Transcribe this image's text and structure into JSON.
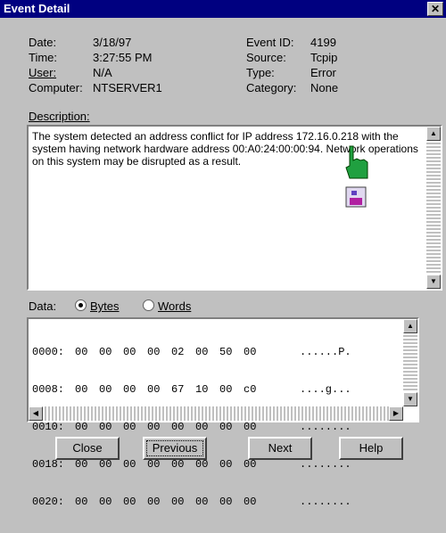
{
  "window": {
    "title": "Event Detail",
    "close_glyph": "✕"
  },
  "fields": {
    "date": {
      "label": "Date:",
      "value": "3/18/97"
    },
    "time": {
      "label": "Time:",
      "value": "3:27:55 PM"
    },
    "user": {
      "label": "User:",
      "value": "N/A"
    },
    "computer": {
      "label": "Computer:",
      "value": "NTSERVER1"
    },
    "event_id": {
      "label": "Event ID:",
      "value": "4199"
    },
    "source": {
      "label": "Source:",
      "value": "Tcpip"
    },
    "type": {
      "label": "Type:",
      "value": "Error"
    },
    "category": {
      "label": "Category:",
      "value": "None"
    }
  },
  "description": {
    "label": "Description:",
    "text": "The system detected an address conflict for IP address 172.16.0.218 with the system having network hardware address 00:A0:24:00:00:94. Network operations on this system may be disrupted as a result."
  },
  "data_section": {
    "label": "Data:",
    "format_options": [
      {
        "label": "Bytes",
        "selected": true
      },
      {
        "label": "Words",
        "selected": false
      }
    ],
    "rows": [
      {
        "addr": "0000:",
        "bytes": [
          "00",
          "00",
          "00",
          "00",
          "02",
          "00",
          "50",
          "00"
        ],
        "ascii": "......P."
      },
      {
        "addr": "0008:",
        "bytes": [
          "00",
          "00",
          "00",
          "00",
          "67",
          "10",
          "00",
          "c0"
        ],
        "ascii": "....g..."
      },
      {
        "addr": "0010:",
        "bytes": [
          "00",
          "00",
          "00",
          "00",
          "00",
          "00",
          "00",
          "00"
        ],
        "ascii": "........"
      },
      {
        "addr": "0018:",
        "bytes": [
          "00",
          "00",
          "00",
          "00",
          "00",
          "00",
          "00",
          "00"
        ],
        "ascii": "........"
      },
      {
        "addr": "0020:",
        "bytes": [
          "00",
          "00",
          "00",
          "00",
          "00",
          "00",
          "00",
          "00"
        ],
        "ascii": "........"
      }
    ]
  },
  "buttons": {
    "close": "Close",
    "previous": "Previous",
    "next": "Next",
    "help": "Help"
  }
}
